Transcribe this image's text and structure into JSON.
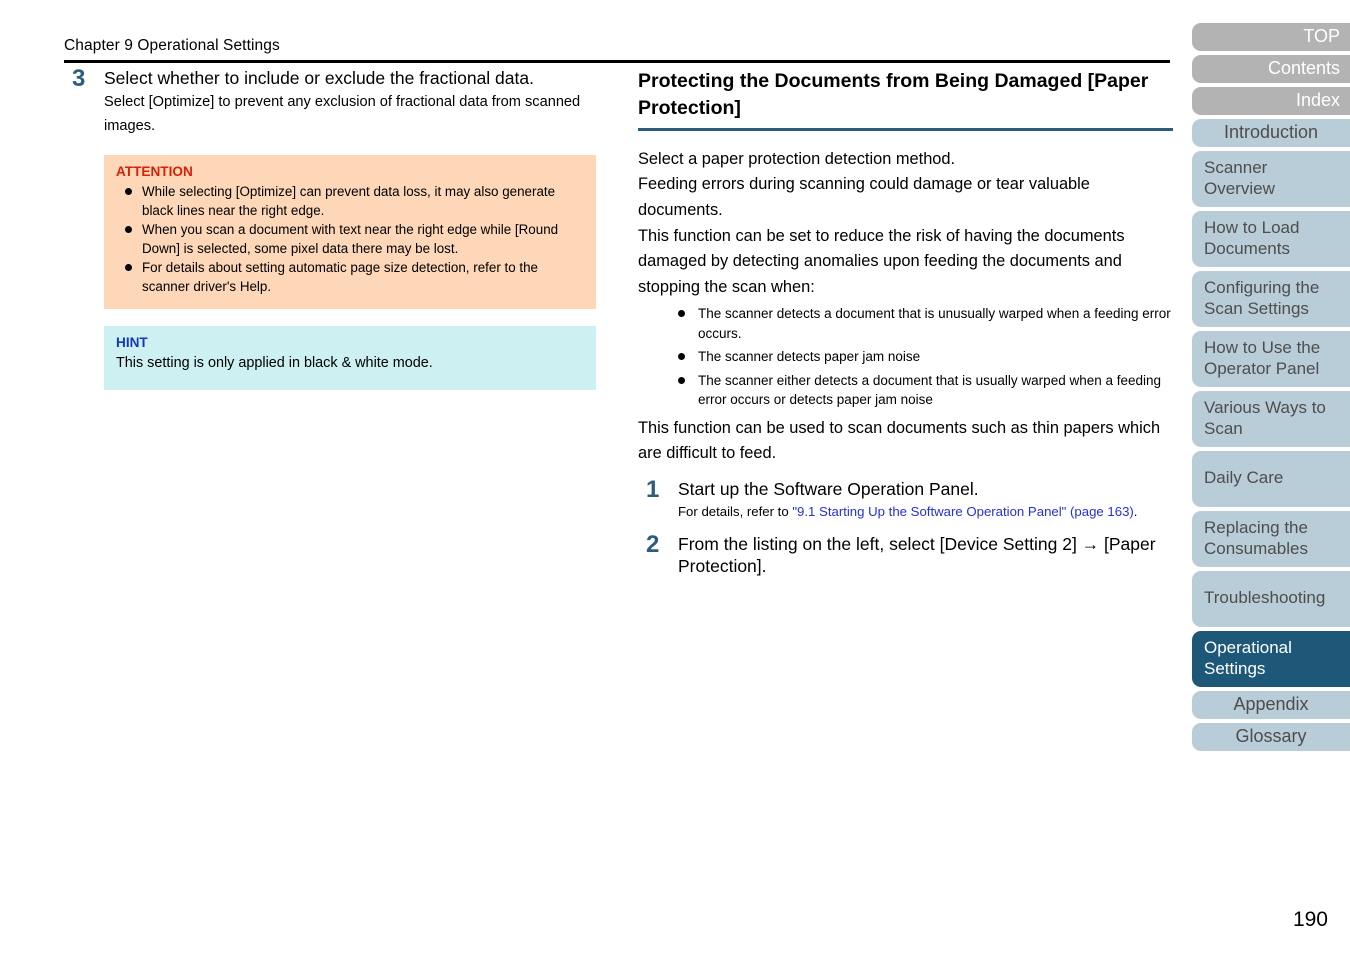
{
  "header": {
    "chapter": "Chapter 9 Operational Settings"
  },
  "left_column": {
    "step": {
      "number": "3",
      "title": "Select whether to include or exclude the fractional data.",
      "body": "Select [Optimize] to prevent any exclusion of fractional data from scanned images."
    },
    "attention": {
      "title": "ATTENTION",
      "items": [
        "While selecting [Optimize] can prevent data loss, it may also generate black lines near the right edge.",
        "When you scan a document with text near the right edge while [Round Down] is selected, some pixel data there may be lost.",
        "For details about setting automatic page size detection, refer to the scanner driver's Help."
      ]
    },
    "hint": {
      "title": "HINT",
      "text": "This setting is only applied in black & white mode."
    }
  },
  "right_column": {
    "heading": "Protecting the Documents from Being Damaged [Paper Protection]",
    "intro_paragraphs": [
      "Select a paper protection detection method.",
      "Feeding errors during scanning could damage or tear valuable documents.",
      "This function can be set to reduce the risk of having the documents damaged by detecting anomalies upon feeding the documents and stopping the scan when:"
    ],
    "bullets": [
      "The scanner detects a document that is unusually warped when a feeding error occurs.",
      "The scanner detects paper jam noise",
      "The scanner either detects a document that is usually warped when a feeding error occurs or detects paper jam noise"
    ],
    "closing_paragraph": "This function can be used to scan documents such as thin papers which are difficult to feed.",
    "steps": [
      {
        "number": "1",
        "title": "Start up the Software Operation Panel.",
        "detail_prefix": "For details, refer to ",
        "link_text": "\"9.1 Starting Up the Software Operation Panel\" (page 163)",
        "detail_suffix": "."
      },
      {
        "number": "2",
        "title": "From the listing on the left, select [Device Setting 2] → [Paper Protection]."
      }
    ]
  },
  "sidebar": {
    "tabs": [
      {
        "label": "TOP",
        "style": "gray"
      },
      {
        "label": "Contents",
        "style": "gray"
      },
      {
        "label": "Index",
        "style": "gray"
      },
      {
        "label": "Introduction",
        "style": "blue-center"
      },
      {
        "label": "Scanner Overview",
        "style": "blue"
      },
      {
        "label": "How to Load Documents",
        "style": "blue"
      },
      {
        "label": "Configuring the Scan Settings",
        "style": "blue"
      },
      {
        "label": "How to Use the Operator Panel",
        "style": "blue"
      },
      {
        "label": "Various Ways to Scan",
        "style": "blue"
      },
      {
        "label": "Daily Care",
        "style": "blue"
      },
      {
        "label": "Replacing the Consumables",
        "style": "blue"
      },
      {
        "label": "Troubleshooting",
        "style": "blue"
      },
      {
        "label": "Operational Settings",
        "style": "blue-active"
      },
      {
        "label": "Appendix",
        "style": "blue-center"
      },
      {
        "label": "Glossary",
        "style": "blue-center"
      }
    ]
  },
  "footer": {
    "page_number": "190"
  },
  "colors": {
    "accent_teal": "#1e5878",
    "step_number": "#2c5d7c",
    "attention_bg": "#fdd7b8",
    "attention_title": "#d82008",
    "hint_bg": "#cdf1f2",
    "hint_title": "#1438b8",
    "tab_gray": "#b3b3b3",
    "tab_blue": "#b9cdd8",
    "link": "#2430dd"
  }
}
